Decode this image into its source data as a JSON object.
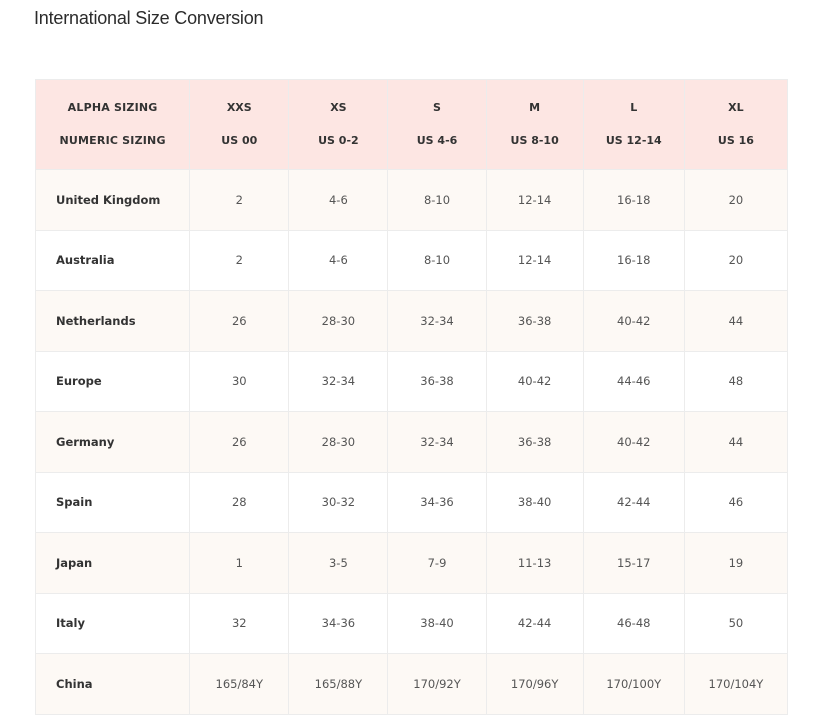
{
  "title": "International Size Conversion",
  "header": {
    "row_labels": [
      "ALPHA SIZING",
      "NUMERIC SIZING"
    ],
    "columns": [
      {
        "alpha": "XXS",
        "numeric": "US 00"
      },
      {
        "alpha": "XS",
        "numeric": "US 0-2"
      },
      {
        "alpha": "S",
        "numeric": "US 4-6"
      },
      {
        "alpha": "M",
        "numeric": "US 8-10"
      },
      {
        "alpha": "L",
        "numeric": "US 12-14"
      },
      {
        "alpha": "XL",
        "numeric": "US 16"
      }
    ]
  },
  "rows": [
    {
      "country": "United Kingdom",
      "values": [
        "2",
        "4-6",
        "8-10",
        "12-14",
        "16-18",
        "20"
      ]
    },
    {
      "country": "Australia",
      "values": [
        "2",
        "4-6",
        "8-10",
        "12-14",
        "16-18",
        "20"
      ]
    },
    {
      "country": "Netherlands",
      "values": [
        "26",
        "28-30",
        "32-34",
        "36-38",
        "40-42",
        "44"
      ]
    },
    {
      "country": "Europe",
      "values": [
        "30",
        "32-34",
        "36-38",
        "40-42",
        "44-46",
        "48"
      ]
    },
    {
      "country": "Germany",
      "values": [
        "26",
        "28-30",
        "32-34",
        "36-38",
        "40-42",
        "44"
      ]
    },
    {
      "country": "Spain",
      "values": [
        "28",
        "30-32",
        "34-36",
        "38-40",
        "42-44",
        "46"
      ]
    },
    {
      "country": "Japan",
      "values": [
        "1",
        "3-5",
        "7-9",
        "11-13",
        "15-17",
        "19"
      ]
    },
    {
      "country": "Italy",
      "values": [
        "32",
        "34-36",
        "38-40",
        "42-44",
        "46-48",
        "50"
      ]
    },
    {
      "country": "China",
      "values": [
        "165/84Y",
        "165/88Y",
        "170/92Y",
        "170/96Y",
        "170/100Y",
        "170/104Y"
      ]
    }
  ],
  "colors": {
    "header_bg": "#fde6e3",
    "odd_row_bg": "#fdf9f5",
    "even_row_bg": "#ffffff",
    "border": "#ececec"
  }
}
